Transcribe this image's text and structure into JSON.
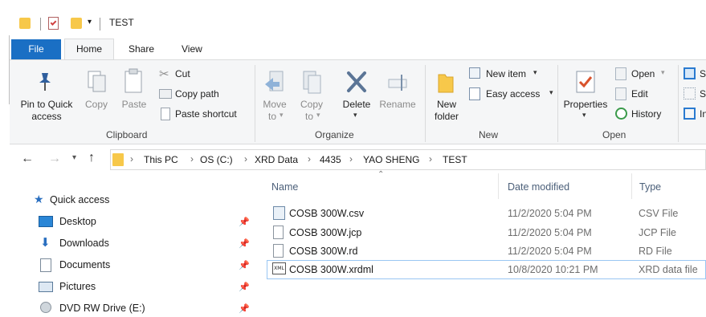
{
  "window": {
    "title": "TEST"
  },
  "tabs": [
    "File",
    "Home",
    "Share",
    "View"
  ],
  "ribbon": {
    "clipboard": {
      "label": "Clipboard",
      "pin_label_1": "Pin to Quick",
      "pin_label_2": "access",
      "copy": "Copy",
      "paste": "Paste",
      "cut": "Cut",
      "copy_path": "Copy path",
      "paste_shortcut": "Paste shortcut"
    },
    "organize": {
      "label": "Organize",
      "move_to_1": "Move",
      "move_to_2": "to",
      "copy_to_1": "Copy",
      "copy_to_2": "to",
      "delete": "Delete",
      "rename": "Rename"
    },
    "new": {
      "label": "New",
      "new_folder_1": "New",
      "new_folder_2": "folder",
      "new_item": "New item",
      "easy_access": "Easy access"
    },
    "open": {
      "label": "Open",
      "properties": "Properties",
      "open": "Open",
      "edit": "Edit",
      "history": "History"
    },
    "select": {
      "s1": "S",
      "s2": "S",
      "s3": "In"
    }
  },
  "address": {
    "crumbs": [
      "This PC",
      "OS (C:)",
      "XRD Data",
      "4435",
      "YAO SHENG",
      "TEST"
    ]
  },
  "nav": {
    "quick_access": "Quick access",
    "items": [
      "Desktop",
      "Downloads",
      "Documents",
      "Pictures",
      "DVD RW Drive (E:)"
    ]
  },
  "files": {
    "columns": [
      "Name",
      "Date modified",
      "Type"
    ],
    "rows": [
      {
        "name": "COSB 300W.csv",
        "date": "11/2/2020 5:04 PM",
        "type": "CSV File"
      },
      {
        "name": "COSB 300W.jcp",
        "date": "11/2/2020 5:04 PM",
        "type": "JCP File"
      },
      {
        "name": "COSB 300W.rd",
        "date": "11/2/2020 5:04 PM",
        "type": "RD File"
      },
      {
        "name": "COSB 300W.xrdml",
        "date": "10/8/2020 10:21 PM",
        "type": "XRD data file"
      }
    ]
  },
  "colors": {
    "accent": "#1a6fc4",
    "folder": "#f7c84a",
    "selection_border": "#99c6f3"
  }
}
